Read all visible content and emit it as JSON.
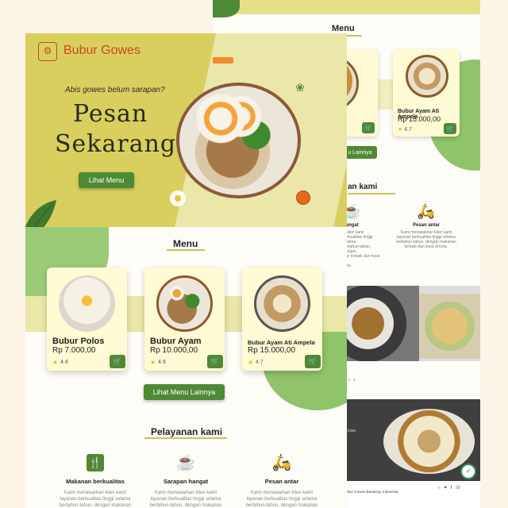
{
  "back": {
    "menu_title": "Menu",
    "cards": [
      {
        "name": "",
        "price": "00",
        "rating": ""
      },
      {
        "name": "Bubur Ayam Ati Ampela",
        "price": "Rp 15.000,00",
        "rating": "4.7"
      }
    ],
    "more_button": "u Lainnya",
    "services_title": "an kami",
    "services": [
      {
        "title": "hangat",
        "desc": "n klien kami\nberkualitas tinggi selama\nbertahun-tahun, dengan\nnan terbaik dan lezat di\nkota."
      },
      {
        "title": "Pesan antar",
        "desc": "Kami menawarkan klien kami\nlayanan berkualitas tinggi selama\nbertahun-tahun, dengan makanan\nterbaik dan lezat di kota."
      }
    ],
    "footer_text": "icies",
    "footer_address": "ubur Gowes Bandung, Indonesia"
  },
  "front": {
    "brand": "Bubur Gowes",
    "tagline": "Abis gowes belum sarapan?",
    "headline_1": "Pesan",
    "headline_2": "Sekarang",
    "hero_button": "Lihat Menu",
    "menu_title": "Menu",
    "cards": [
      {
        "name": "Bubur Polos",
        "price": "Rp 7.000,00",
        "rating": "4.4"
      },
      {
        "name": "Bubur Ayam",
        "price": "Rp 10.000,00",
        "rating": "4.9"
      },
      {
        "name": "Bubur Ayam Ati Ampela",
        "price": "Rp 15.000,00",
        "rating": "4.7"
      }
    ],
    "more_button": "Lihat Menu Lainnya",
    "services_title": "Pelayanan kami",
    "services": [
      {
        "title": "Makanan berkualitas",
        "desc": "Kami menawarkan klien kami\nlayanan berkualitas tinggi selama\nbertahun-tahun, dengan makanan"
      },
      {
        "title": "Sarapan hangat",
        "desc": "Kami menawarkan klien kami\nlayanan berkualitas tinggi selama\nbertahun-tahun, dengan makanan"
      },
      {
        "title": "Pesan antar",
        "desc": "Kami menawarkan klien kami\nlayanan berkualitas tinggi selama\nbertahun-tahun, dengan makanan"
      }
    ]
  },
  "colors": {
    "primary_green": "#4e8a35",
    "hero_yellow": "#d9cf5f",
    "brand_red": "#c84a20",
    "card_bg": "#fffbd4"
  },
  "icons": [
    "logo-icon",
    "cart-icon",
    "star-icon",
    "cutlery-icon",
    "bowl-icon",
    "scooter-icon",
    "leaf-icon",
    "egg-icon",
    "tomato-icon"
  ]
}
